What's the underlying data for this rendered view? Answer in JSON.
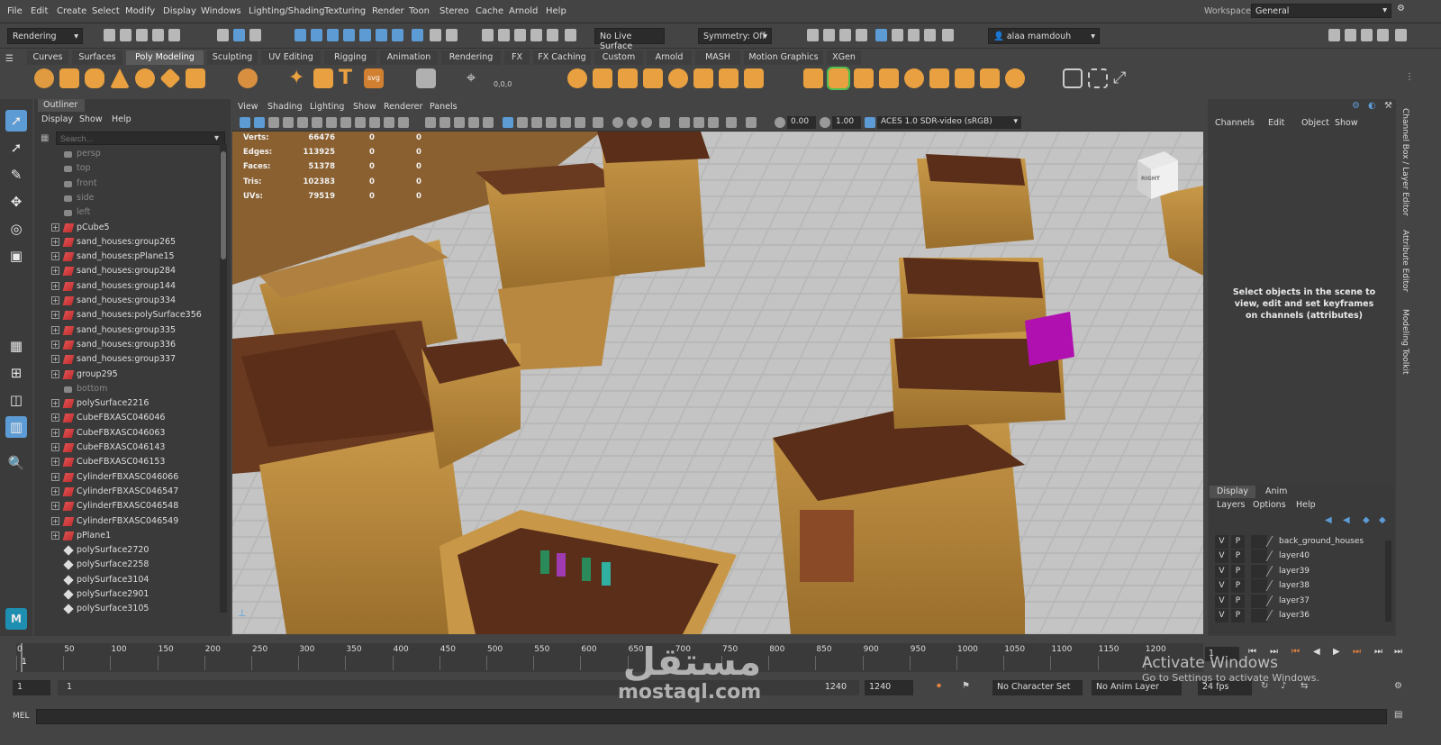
{
  "menubar": {
    "items": [
      "File",
      "Edit",
      "Create",
      "Select",
      "Modify",
      "Display",
      "Windows",
      "Lighting/Shading",
      "Texturing",
      "Render",
      "Toon",
      "Stereo",
      "Cache",
      "Arnold",
      "Help"
    ],
    "workspace_label": "Workspace:",
    "workspace_value": "General"
  },
  "toolbar": {
    "menuset": "Rendering",
    "live_surface": "No Live Surface",
    "symmetry": "Symmetry: Off",
    "user": "alaa mamdouh"
  },
  "shelf": {
    "tabs": [
      "Curves",
      "Surfaces",
      "Poly Modeling",
      "Sculpting",
      "UV Editing",
      "Rigging",
      "Animation",
      "Rendering",
      "FX",
      "FX Caching",
      "Custom",
      "Arnold",
      "MASH",
      "Motion Graphics",
      "XGen"
    ],
    "active_tab": "Poly Modeling",
    "svg_label": "svg",
    "coords_label": "0,0,0"
  },
  "outliner": {
    "title": "Outliner",
    "menu": [
      "Display",
      "Show",
      "Help"
    ],
    "search_placeholder": "Search...",
    "items": [
      {
        "label": "persp",
        "icon": "camera-icon",
        "dim": true,
        "expand": false
      },
      {
        "label": "top",
        "icon": "camera-icon",
        "dim": true,
        "expand": false
      },
      {
        "label": "front",
        "icon": "camera-icon",
        "dim": true,
        "expand": false
      },
      {
        "label": "side",
        "icon": "camera-icon",
        "dim": true,
        "expand": false
      },
      {
        "label": "left",
        "icon": "camera-icon",
        "dim": true,
        "expand": false
      },
      {
        "label": "pCube5",
        "icon": "mesh-icon",
        "dim": false,
        "expand": true
      },
      {
        "label": "sand_houses:group265",
        "icon": "mesh-icon",
        "dim": false,
        "expand": true
      },
      {
        "label": "sand_houses:pPlane15",
        "icon": "mesh-icon",
        "dim": false,
        "expand": true
      },
      {
        "label": "sand_houses:group284",
        "icon": "mesh-icon",
        "dim": false,
        "expand": true
      },
      {
        "label": "sand_houses:group144",
        "icon": "mesh-icon",
        "dim": false,
        "expand": true
      },
      {
        "label": "sand_houses:group334",
        "icon": "mesh-icon",
        "dim": false,
        "expand": true
      },
      {
        "label": "sand_houses:polySurface356",
        "icon": "mesh-icon",
        "dim": false,
        "expand": true
      },
      {
        "label": "sand_houses:group335",
        "icon": "mesh-icon",
        "dim": false,
        "expand": true
      },
      {
        "label": "sand_houses:group336",
        "icon": "mesh-icon",
        "dim": false,
        "expand": true
      },
      {
        "label": "sand_houses:group337",
        "icon": "mesh-icon",
        "dim": false,
        "expand": true
      },
      {
        "label": "group295",
        "icon": "mesh-icon",
        "dim": false,
        "expand": true
      },
      {
        "label": "bottom",
        "icon": "camera-icon",
        "dim": true,
        "expand": false
      },
      {
        "label": "polySurface2216",
        "icon": "mesh-icon",
        "dim": false,
        "expand": true
      },
      {
        "label": "CubeFBXASC046046",
        "icon": "mesh-icon",
        "dim": false,
        "expand": true
      },
      {
        "label": "CubeFBXASC046063",
        "icon": "mesh-icon",
        "dim": false,
        "expand": true
      },
      {
        "label": "CubeFBXASC046143",
        "icon": "mesh-icon",
        "dim": false,
        "expand": true
      },
      {
        "label": "CubeFBXASC046153",
        "icon": "mesh-icon",
        "dim": false,
        "expand": true
      },
      {
        "label": "CylinderFBXASC046066",
        "icon": "mesh-icon",
        "dim": false,
        "expand": true
      },
      {
        "label": "CylinderFBXASC046547",
        "icon": "mesh-icon",
        "dim": false,
        "expand": true
      },
      {
        "label": "CylinderFBXASC046548",
        "icon": "mesh-icon",
        "dim": false,
        "expand": true
      },
      {
        "label": "CylinderFBXASC046549",
        "icon": "mesh-icon",
        "dim": false,
        "expand": true
      },
      {
        "label": "pPlane1",
        "icon": "mesh-icon",
        "dim": false,
        "expand": true
      },
      {
        "label": "polySurface2720",
        "icon": "poly-icon",
        "dim": false,
        "expand": false
      },
      {
        "label": "polySurface2258",
        "icon": "poly-icon",
        "dim": false,
        "expand": false
      },
      {
        "label": "polySurface3104",
        "icon": "poly-icon",
        "dim": false,
        "expand": false
      },
      {
        "label": "polySurface2901",
        "icon": "poly-icon",
        "dim": false,
        "expand": false
      },
      {
        "label": "polySurface3105",
        "icon": "poly-icon",
        "dim": false,
        "expand": false
      }
    ]
  },
  "viewport": {
    "menu": [
      "View",
      "Shading",
      "Lighting",
      "Show",
      "Renderer",
      "Panels"
    ],
    "exposure": "0.00",
    "gamma": "1.00",
    "color_space": "ACES 1.0 SDR-video (sRGB)",
    "viewcube_label": "RIGHT",
    "hud": [
      {
        "label": "Verts:",
        "v1": "66476",
        "v2": "0",
        "v3": "0"
      },
      {
        "label": "Edges:",
        "v1": "113925",
        "v2": "0",
        "v3": "0"
      },
      {
        "label": "Faces:",
        "v1": "51378",
        "v2": "0",
        "v3": "0"
      },
      {
        "label": "Tris:",
        "v1": "102383",
        "v2": "0",
        "v3": "0"
      },
      {
        "label": "UVs:",
        "v1": "79519",
        "v2": "0",
        "v3": "0"
      }
    ]
  },
  "channelbox": {
    "menu": [
      "Channels",
      "Edit",
      "Object",
      "Show"
    ],
    "message": "Select objects in the scene to view, edit and set keyframes on channels (attributes)"
  },
  "layers": {
    "tabs": [
      "Display",
      "Anim"
    ],
    "active_tab": "Display",
    "menu": [
      "Layers",
      "Options",
      "Help"
    ],
    "rows": [
      {
        "v": "V",
        "p": "P",
        "name": "back_ground_houses"
      },
      {
        "v": "V",
        "p": "P",
        "name": "layer40"
      },
      {
        "v": "V",
        "p": "P",
        "name": "layer39"
      },
      {
        "v": "V",
        "p": "P",
        "name": "layer38"
      },
      {
        "v": "V",
        "p": "P",
        "name": "layer37"
      },
      {
        "v": "V",
        "p": "P",
        "name": "layer36"
      }
    ]
  },
  "side_tabs": [
    "Channel Box / Layer Editor",
    "Attribute Editor",
    "Modeling Toolkit"
  ],
  "timeline": {
    "ticks": [
      "0",
      "50",
      "100",
      "150",
      "200",
      "250",
      "300",
      "350",
      "400",
      "450",
      "500",
      "550",
      "600",
      "650",
      "700",
      "750",
      "800",
      "850",
      "900",
      "950",
      "1000",
      "1050",
      "1100",
      "1150",
      "1200"
    ],
    "current_frame_marker": "1",
    "current_frame": "1"
  },
  "range": {
    "start": "1",
    "playback_start": "1",
    "playback_end": "1240",
    "end": "1240",
    "character_set": "No Character Set",
    "anim_layer": "No Anim Layer",
    "fps": "24 fps"
  },
  "mel": {
    "label": "MEL"
  },
  "watermark": {
    "arabic": "مستقل",
    "site": "mostaql.com"
  },
  "activate": {
    "title": "Activate Windows",
    "subtitle": "Go to Settings to activate Windows."
  },
  "colors": {
    "accent": "#5d9bd5",
    "panel": "#444444",
    "shelf_icon": "#e8a040",
    "house": "#c89848",
    "roof": "#5a2e18"
  }
}
